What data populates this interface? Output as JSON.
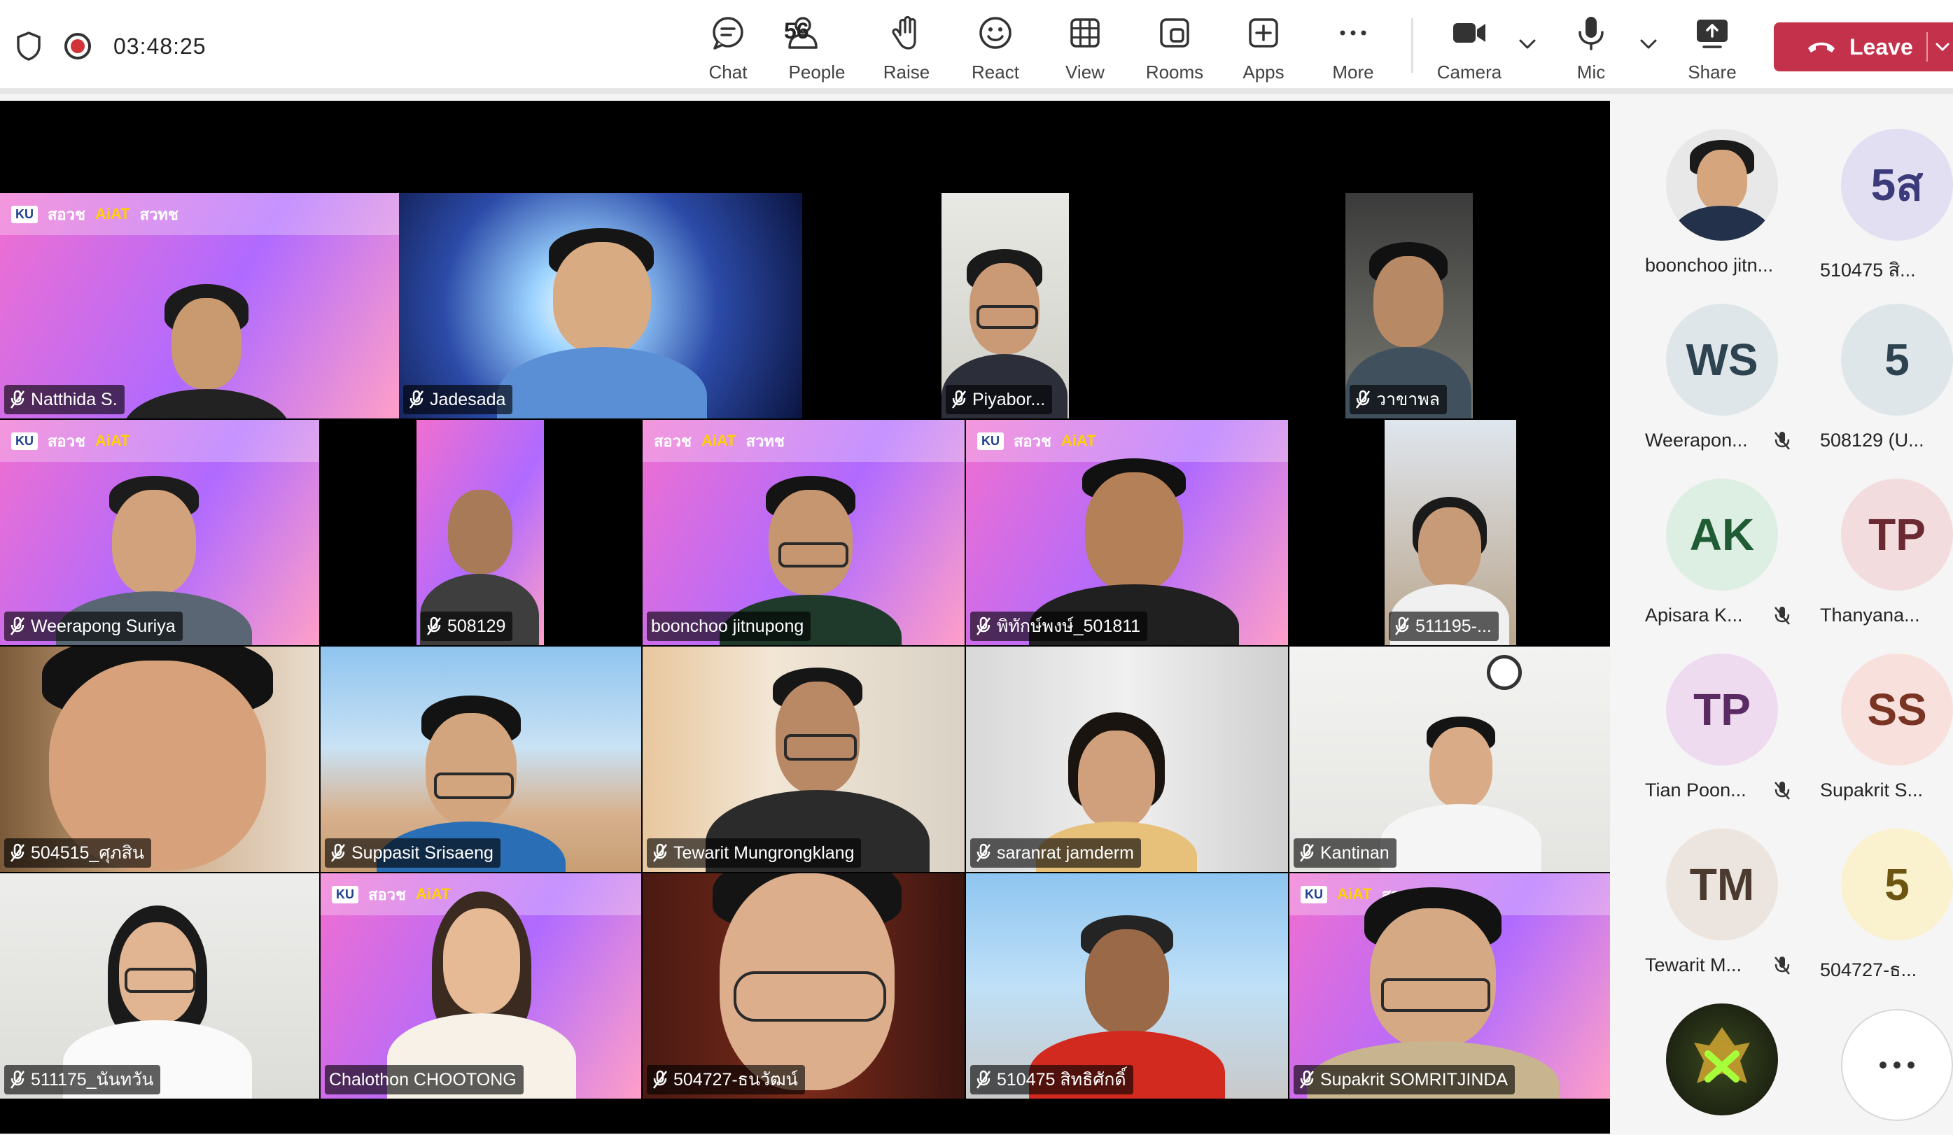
{
  "toolbar": {
    "timer": "03:48:25",
    "people_count": "56",
    "buttons": {
      "chat": "Chat",
      "people": "People",
      "raise": "Raise",
      "react": "React",
      "view": "View",
      "rooms": "Rooms",
      "apps": "Apps",
      "more": "More",
      "camera": "Camera",
      "mic": "Mic",
      "share": "Share"
    },
    "leave": "Leave"
  },
  "tiles": [
    {
      "name": "Natthida S."
    },
    {
      "name": "Jadesada"
    },
    {
      "name": "Piyabor..."
    },
    {
      "name": "วาขาพล"
    },
    {
      "name": "Weerapong Suriya"
    },
    {
      "name": "508129"
    },
    {
      "name": "boonchoo jitnupong"
    },
    {
      "name": "พิทักษ์พงษ์_501811"
    },
    {
      "name": "511195-..."
    },
    {
      "name": "504515_ศุภสิน"
    },
    {
      "name": "Suppasit Srisaeng"
    },
    {
      "name": "Tewarit Mungrongklang"
    },
    {
      "name": "saranrat jamderm"
    },
    {
      "name": "Kantinan"
    },
    {
      "name": "511175_นันทวัน"
    },
    {
      "name": "Chalothon CHOOTONG"
    },
    {
      "name": "504727-ธนวัฒน์"
    },
    {
      "name": "510475 สิทธิศักดิ์"
    },
    {
      "name": "Supakrit SOMRITJINDA"
    }
  ],
  "banner": {
    "ku": "KU",
    "brand": "สอวช",
    "aiat": "AiAT",
    "nstda": "สวทช"
  },
  "participants": [
    {
      "name": "boonchoo jitn...",
      "initials": "",
      "muted": false,
      "bg": "#ffffff",
      "fg": "#242424"
    },
    {
      "name": "510475 สิ...",
      "initials": "5ส",
      "muted": false,
      "bg": "#e1dff1",
      "fg": "#3b3a7a"
    },
    {
      "name": "Weerapon...",
      "initials": "WS",
      "muted": true,
      "bg": "#dfe6ea",
      "fg": "#2d4350"
    },
    {
      "name": "508129 (U...",
      "initials": "5",
      "muted": false,
      "bg": "#dfe6ea",
      "fg": "#2d4350"
    },
    {
      "name": "Apisara K...",
      "initials": "AK",
      "muted": true,
      "bg": "#dcefe2",
      "fg": "#1f5c33"
    },
    {
      "name": "Thanyana...",
      "initials": "TP",
      "muted": false,
      "bg": "#f3dcde",
      "fg": "#6b2a31"
    },
    {
      "name": "Tian Poon...",
      "initials": "TP",
      "muted": true,
      "bg": "#eedbf0",
      "fg": "#5a2a63"
    },
    {
      "name": "Supakrit S...",
      "initials": "SS",
      "muted": false,
      "bg": "#f8e1dc",
      "fg": "#7a3424"
    },
    {
      "name": "Tewarit M...",
      "initials": "TM",
      "muted": true,
      "bg": "#ece4de",
      "fg": "#4a3a30"
    },
    {
      "name": "504727-ธ...",
      "initials": "5",
      "muted": false,
      "bg": "#faf1cf",
      "fg": "#6b5510"
    },
    {
      "name": "",
      "initials": "",
      "muted": false,
      "bg": "#2a2f1e",
      "fg": "#a6ff3a"
    }
  ],
  "colors": {
    "leave": "#c4314b",
    "record": "#d13438",
    "stage": "#000000"
  }
}
